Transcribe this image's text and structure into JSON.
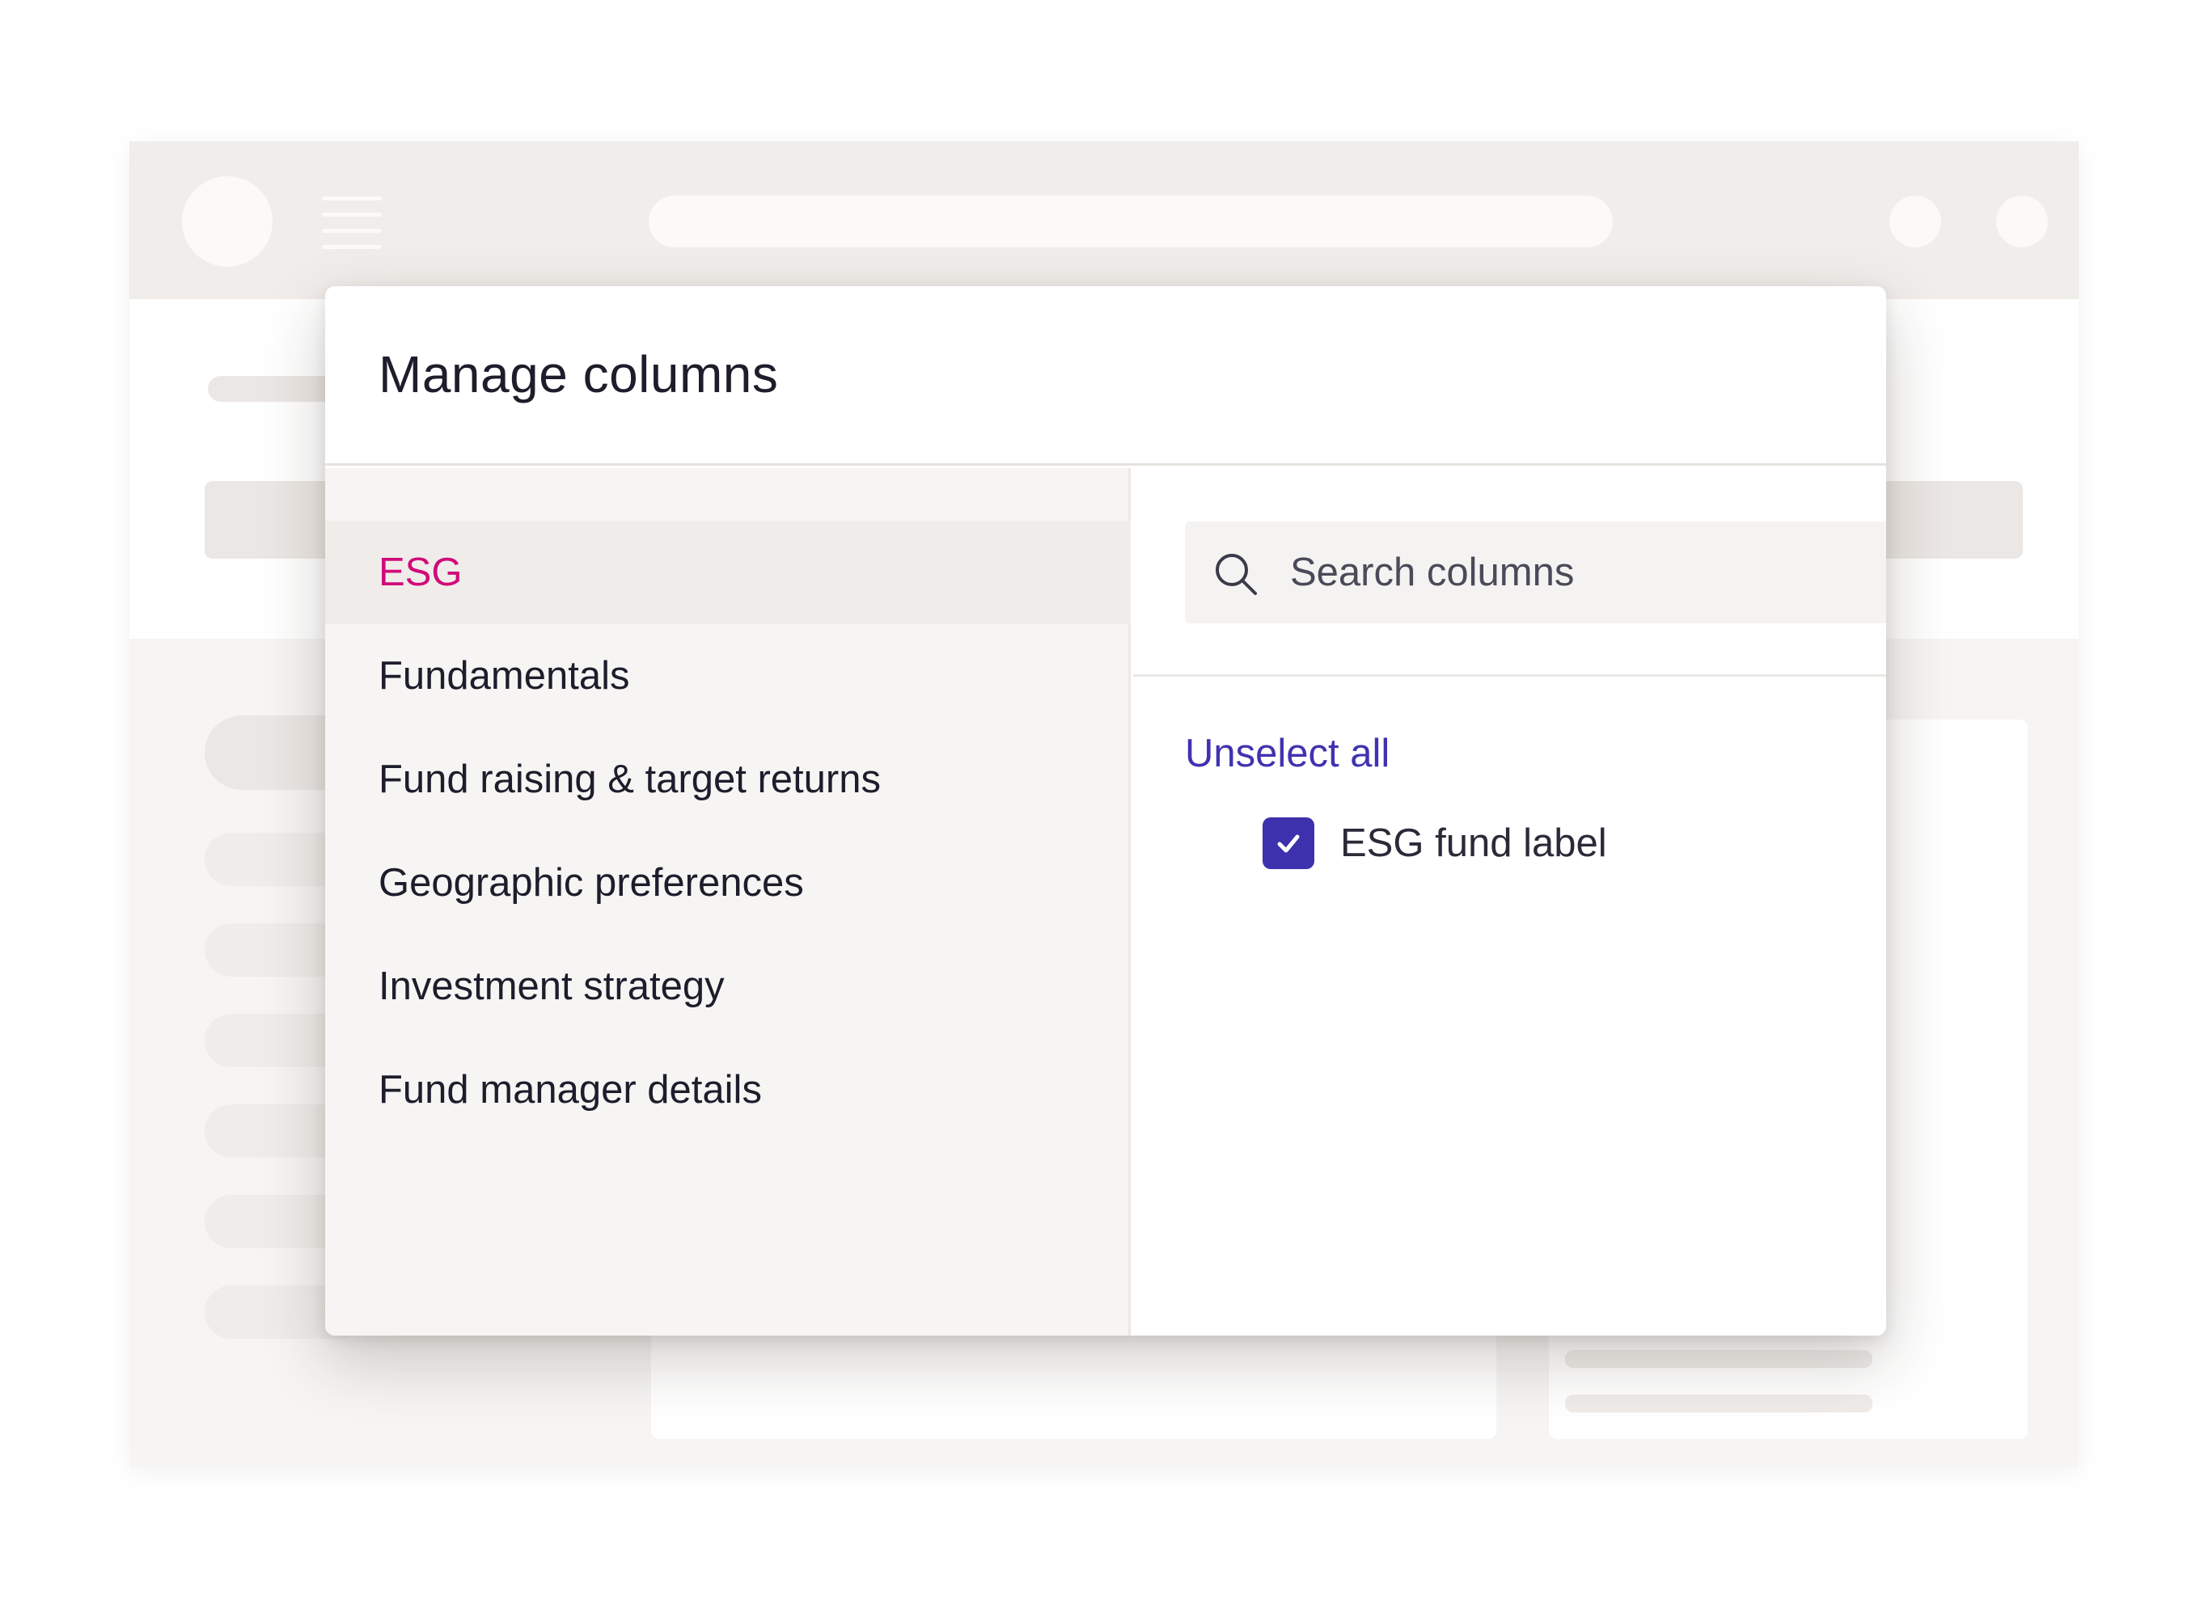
{
  "modal": {
    "title": "Manage columns",
    "categories": [
      {
        "label": "ESG",
        "active": true
      },
      {
        "label": "Fundamentals",
        "active": false
      },
      {
        "label": "Fund raising & target returns",
        "active": false
      },
      {
        "label": "Geographic preferences",
        "active": false
      },
      {
        "label": "Investment strategy",
        "active": false
      },
      {
        "label": "Fund manager details",
        "active": false
      }
    ],
    "search": {
      "placeholder": "Search columns",
      "icon": "search-icon"
    },
    "unselect_all_label": "Unselect all",
    "options": [
      {
        "label": "ESG fund label",
        "checked": true
      }
    ]
  },
  "colors": {
    "accent_active_category": "#d10a7a",
    "link": "#3f33b0",
    "checkbox": "#3d31ad",
    "text": "#1d1d2b"
  }
}
